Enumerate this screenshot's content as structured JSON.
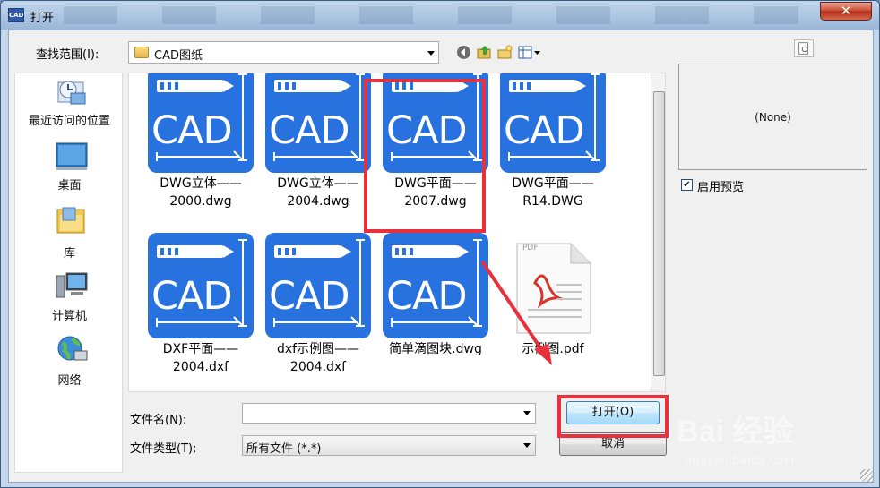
{
  "window": {
    "title": "打开",
    "close_label": "✕"
  },
  "lookin": {
    "label": "查找范围(I):",
    "value": "CAD图纸"
  },
  "places": [
    {
      "label": "最近访问的位置",
      "icon": "recent-places-icon"
    },
    {
      "label": "桌面",
      "icon": "desktop-icon"
    },
    {
      "label": "库",
      "icon": "libraries-icon"
    },
    {
      "label": "计算机",
      "icon": "computer-icon"
    },
    {
      "label": "网络",
      "icon": "network-icon"
    }
  ],
  "cad_icon_text": "CAD",
  "files": [
    {
      "line1": "DWG立体——",
      "line2": "2000.dwg",
      "type": "cad"
    },
    {
      "line1": "DWG立体——",
      "line2": "2004.dwg",
      "type": "cad"
    },
    {
      "line1": "DWG平面——",
      "line2": "2007.dwg",
      "type": "cad"
    },
    {
      "line1": "DWG平面——",
      "line2": "R14.DWG",
      "type": "cad"
    },
    {
      "line1": "DXF平面——",
      "line2": "2004.dxf",
      "type": "cad"
    },
    {
      "line1": "dxf示例图——",
      "line2": "2004.dxf",
      "type": "cad"
    },
    {
      "line1": "简单滴图块.dwg",
      "line2": "",
      "type": "cad"
    },
    {
      "line1": "示例图.pdf",
      "line2": "",
      "type": "pdf",
      "pdf_badge": "PDF"
    }
  ],
  "preview": {
    "none_text": "(None)",
    "checkbox_label": "启用预览",
    "checked": true
  },
  "filename": {
    "label": "文件名(N):",
    "value": ""
  },
  "filetype": {
    "label": "文件类型(T):",
    "value": "所有文件 (*.*)"
  },
  "buttons": {
    "open": "打开(O)",
    "cancel": "取消"
  },
  "watermark": {
    "logo": "Bai 经验",
    "sub": "jingyan.baidu.com"
  },
  "colors": {
    "cad_blue": "#2872e0",
    "highlight_red": "#e8313c"
  }
}
